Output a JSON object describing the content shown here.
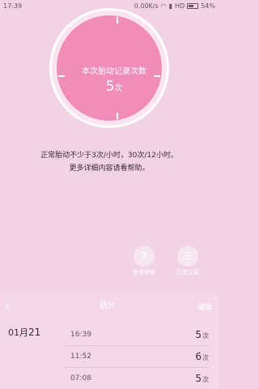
{
  "status_bar": {
    "time": "17:39",
    "net_speed": "0.00K/s",
    "carrier": "HD",
    "battery": "54%",
    "battery_level": 0.54
  },
  "dial": {
    "title": "本次胎动记录次数",
    "value": "5",
    "unit": "次"
  },
  "info": {
    "line1": "正常胎动不少于3次/小时，30次/12小时。",
    "line2": "更多详细内容请看帮助。"
  },
  "actions": {
    "help_icon": "?",
    "help_label": "查看帮助",
    "history_icon": "☰",
    "history_label": "历史记录"
  },
  "panel": {
    "back_icon": "‹",
    "title": "统计",
    "edit_label": "编辑"
  },
  "records": {
    "date_month": "01月",
    "date_day": "21",
    "rows": [
      {
        "time": "16:39",
        "count": "5",
        "unit": "次"
      },
      {
        "time": "11:52",
        "count": "6",
        "unit": "次"
      },
      {
        "time": "07:08",
        "count": "5",
        "unit": "次"
      }
    ]
  },
  "colors": {
    "background": "#f2d3e6",
    "dial_accent": "#f08cb8",
    "dial_ring": "#fbe3f0"
  }
}
